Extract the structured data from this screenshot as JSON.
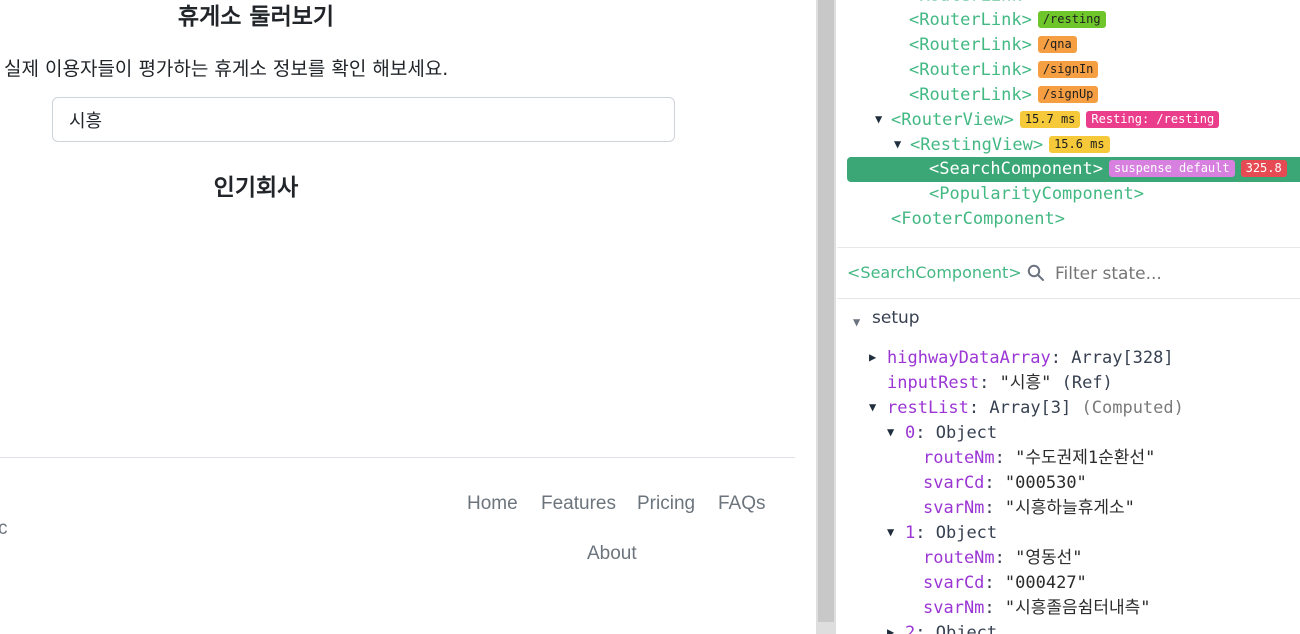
{
  "app": {
    "title": "휴게소 둘러보기",
    "description": "실제 이용자들이 평가하는 휴게소 정보를 확인 해보세요.",
    "search_value": "시흥",
    "section_title": "인기회사",
    "footer_links": [
      "Home",
      "Features",
      "Pricing",
      "FAQs",
      "About"
    ],
    "footer_fragment": "c"
  },
  "devtools": {
    "tree": {
      "router_link": "<RouterLink>",
      "routes": [
        "/resting",
        "/qna",
        "/signIn",
        "/signUp"
      ],
      "router_view": "<RouterView>",
      "router_view_time": "15.7 ms",
      "router_view_badge": "Resting: /resting",
      "resting_view": "<RestingView>",
      "resting_view_time": "15.6 ms",
      "search_component": "<SearchComponent>",
      "search_badge": "suspense default",
      "search_time": "325.8",
      "popularity_component": "<PopularityComponent>",
      "footer_component": "<FooterComponent>"
    },
    "inspector": {
      "component": "<SearchComponent>",
      "filter_placeholder": "Filter state...",
      "setup_label": "setup"
    },
    "state": {
      "highway_key": "highwayDataArray",
      "highway_val": "Array[328]",
      "input_key": "inputRest",
      "input_val": "\"시흥\"",
      "input_note": "(Ref)",
      "rest_key": "restList",
      "rest_val": "Array[3]",
      "rest_note": "(Computed)",
      "items": [
        {
          "index": "0",
          "type": "Object",
          "fields": [
            {
              "key": "routeNm",
              "value": "\"수도권제1순환선\""
            },
            {
              "key": "svarCd",
              "value": "\"000530\""
            },
            {
              "key": "svarNm",
              "value": "\"시흥하늘휴게소\""
            }
          ]
        },
        {
          "index": "1",
          "type": "Object",
          "fields": [
            {
              "key": "routeNm",
              "value": "\"영동선\""
            },
            {
              "key": "svarCd",
              "value": "\"000427\""
            },
            {
              "key": "svarNm",
              "value": "\"시흥졸음쉼터내측\""
            }
          ]
        },
        {
          "index": "2",
          "type": "Object"
        }
      ]
    }
  }
}
